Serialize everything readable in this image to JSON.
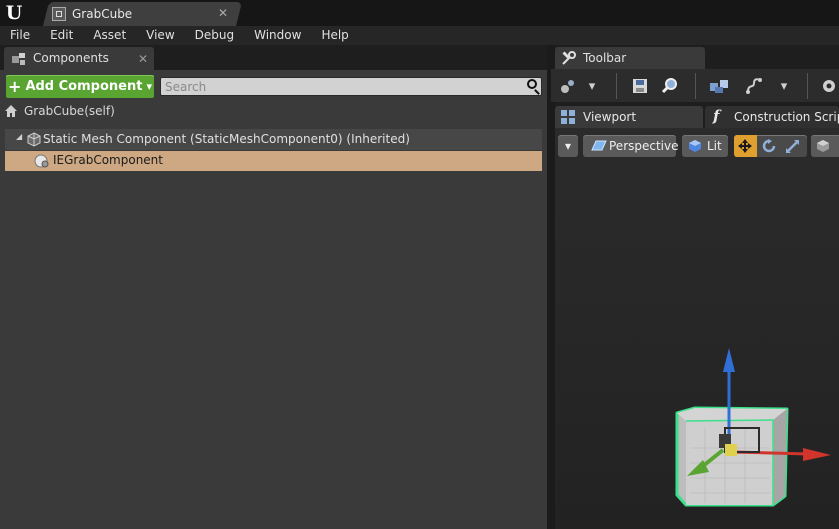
{
  "window": {
    "tab_title": "GrabCube",
    "logo_text": "U"
  },
  "menu": [
    "File",
    "Edit",
    "Asset",
    "View",
    "Debug",
    "Window",
    "Help"
  ],
  "components_panel": {
    "tab_label": "Components",
    "add_button_label": "Add Component",
    "search_placeholder": "Search",
    "self_label": "GrabCube(self)",
    "tree": [
      {
        "label": "Static Mesh Component (StaticMeshComponent0) (Inherited)",
        "expanded": true
      },
      {
        "label": "IEGrabComponent",
        "selected": true
      }
    ]
  },
  "toolbar_panel": {
    "tab_label": "Toolbar"
  },
  "viewport_tabs": {
    "viewport": "Viewport",
    "construction": "Construction Scrip",
    "construction_glyph": "f"
  },
  "viewport_toolbar": {
    "perspective": "Perspective",
    "lit": "Lit"
  },
  "glyphs": {
    "close": "✕",
    "plus": "+",
    "dropdown": "▾",
    "expand": "◢"
  },
  "colors": {
    "accent_green": "#5aa532",
    "selection": "#cda883",
    "axis_x": "#d0342a",
    "axis_y": "#5aa532",
    "axis_z": "#2f6fd6",
    "outline": "#3be08a"
  }
}
